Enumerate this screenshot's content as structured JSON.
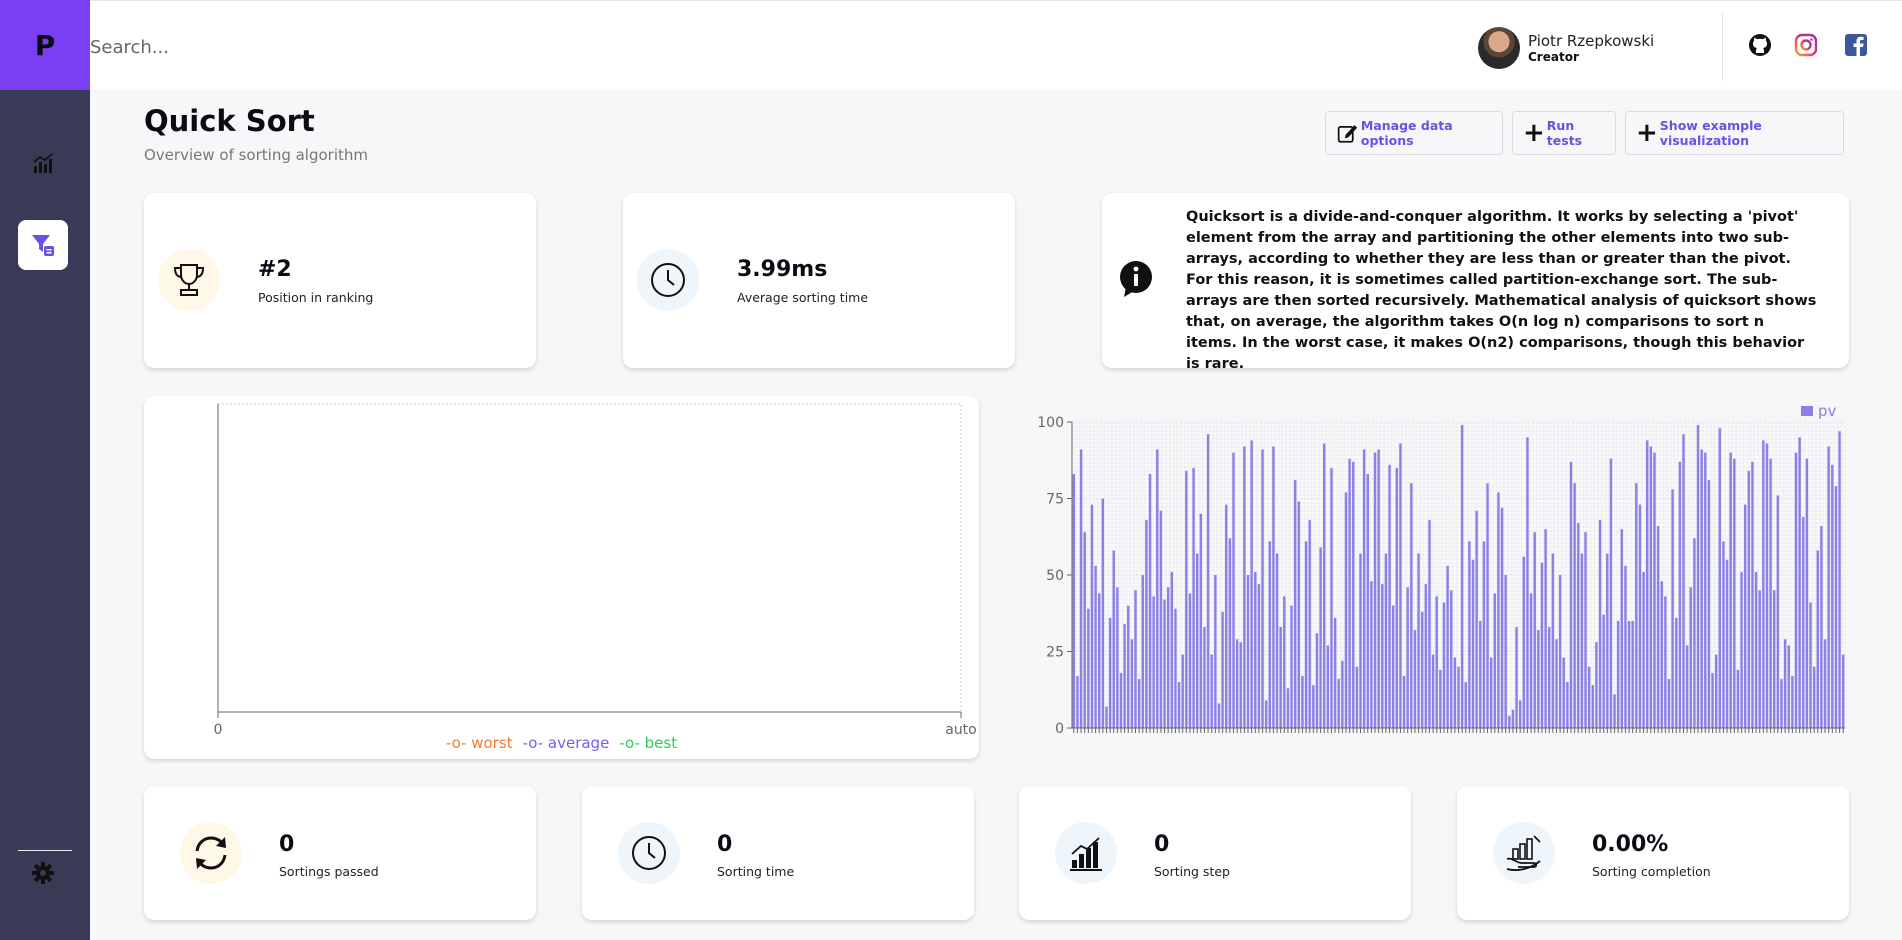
{
  "app": {
    "logo_letter": "P"
  },
  "sidebar": {
    "items": [
      {
        "icon": "chart-icon",
        "active": false
      },
      {
        "icon": "sort-filter-icon",
        "active": true
      }
    ],
    "bottom_icon": "gear-icon"
  },
  "header": {
    "search_placeholder": "Search...",
    "user": {
      "name": "Piotr Rzepkowski",
      "role": "Creator"
    },
    "social_icons": [
      "github-icon",
      "instagram-icon",
      "facebook-icon"
    ]
  },
  "page": {
    "title": "Quick Sort",
    "subtitle": "Overview of sorting algorithm",
    "actions": [
      {
        "label": "Manage data options",
        "icon": "edit-icon"
      },
      {
        "label": "Run tests",
        "icon": "plus-icon"
      },
      {
        "label": "Show example visualization",
        "icon": "plus-icon"
      }
    ]
  },
  "stats_top": [
    {
      "value": "#2",
      "label": "Position in ranking",
      "icon": "trophy-icon"
    },
    {
      "value": "3.99ms",
      "label": "Average sorting time",
      "icon": "clock-icon"
    }
  ],
  "info": {
    "icon": "info-icon",
    "text": "Quicksort is a divide-and-conquer algorithm. It works by selecting a 'pivot' element from the array and partitioning the other elements into two sub-arrays, according to whether they are less than or greater than the pivot. For this reason, it is sometimes called partition-exchange sort. The sub-arrays are then sorted recursively. Mathematical analysis of quicksort shows that, on average, the algorithm takes O(n log n) comparisons to sort n items. In the worst case, it makes O(n2) comparisons, though this behavior is rare."
  },
  "stats_bottom": [
    {
      "value": "0",
      "label": "Sortings passed",
      "icon": "refresh-icon"
    },
    {
      "value": "0",
      "label": "Sorting time",
      "icon": "clock-icon"
    },
    {
      "value": "0",
      "label": "Sorting step",
      "icon": "bar-growth-icon"
    },
    {
      "value": "0.00%",
      "label": "Sorting completion",
      "icon": "hand-chart-icon"
    }
  ],
  "chart_data": [
    {
      "type": "line",
      "x_ticks": [
        "0",
        "auto"
      ],
      "series": [
        {
          "name": "worst",
          "color": "#f5792a",
          "values": []
        },
        {
          "name": "average",
          "color": "#7a5cf0",
          "values": []
        },
        {
          "name": "best",
          "color": "#2ecc52",
          "values": []
        }
      ],
      "legend_position": "bottom-center",
      "grid": false
    },
    {
      "type": "bar",
      "color": "#8b80e6",
      "legend_position": "top-right",
      "grid": true,
      "ylim": [
        0,
        100
      ],
      "y_ticks": [
        0,
        25,
        50,
        75,
        100
      ],
      "series": [
        {
          "name": "pv",
          "values": [
            83,
            17,
            91,
            64,
            39,
            73,
            53,
            44,
            75,
            7,
            36,
            58,
            46,
            18,
            34,
            40,
            29,
            45,
            16,
            50,
            68,
            83,
            43,
            91,
            71,
            42,
            46,
            51,
            39,
            15,
            24,
            84,
            44,
            85,
            57,
            70,
            33,
            96,
            24,
            50,
            8,
            38,
            73,
            62,
            90,
            29,
            28,
            92,
            50,
            94,
            51,
            47,
            91,
            9,
            61,
            92,
            57,
            33,
            43,
            13,
            40,
            81,
            74,
            17,
            61,
            68,
            14,
            31,
            59,
            93,
            27,
            85,
            36,
            16,
            22,
            77,
            88,
            87,
            20,
            57,
            91,
            83,
            48,
            90,
            91,
            47,
            57,
            86,
            40,
            85,
            93,
            17,
            46,
            80,
            32,
            57,
            38,
            47,
            68,
            24,
            43,
            19,
            41,
            53,
            45,
            23,
            20,
            99,
            15,
            61,
            55,
            71,
            35,
            61,
            80,
            23,
            44,
            77,
            72,
            50,
            4,
            6,
            33,
            9,
            56,
            95,
            44,
            64,
            32,
            54,
            65,
            33,
            57,
            29,
            50,
            23,
            15,
            87,
            80,
            67,
            57,
            64,
            20,
            14,
            28,
            68,
            37,
            57,
            88,
            11,
            35,
            65,
            53,
            35,
            35,
            80,
            73,
            51,
            94,
            92,
            90,
            66,
            48,
            43,
            16,
            78,
            36,
            87,
            96,
            27,
            46,
            62,
            99,
            91,
            90,
            81,
            18,
            24,
            98,
            61,
            55,
            90,
            88,
            19,
            51,
            73,
            84,
            87,
            51,
            45,
            94,
            93,
            88,
            45,
            76,
            16,
            29,
            27,
            17,
            90,
            95,
            69,
            88,
            41,
            20,
            58,
            66,
            29,
            92,
            86,
            79,
            97,
            24
          ]
        }
      ]
    }
  ]
}
